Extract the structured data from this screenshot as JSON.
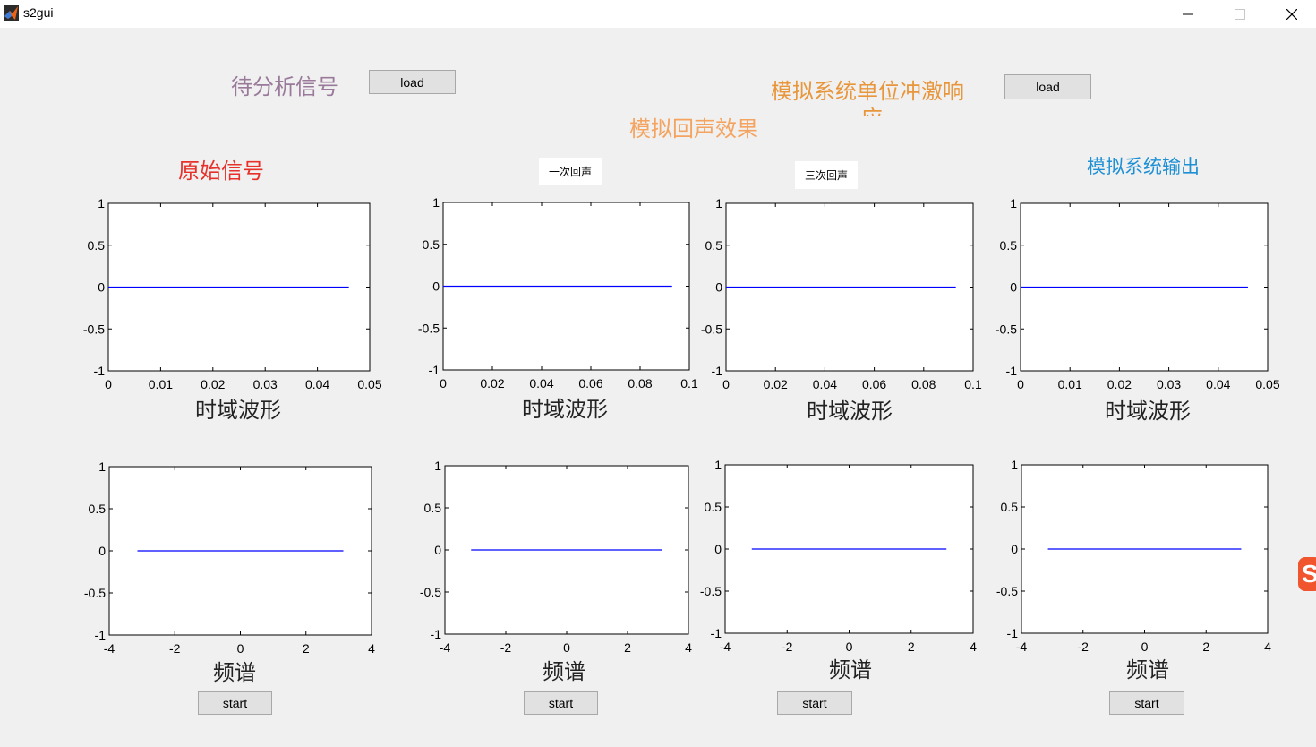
{
  "window": {
    "title": "s2gui"
  },
  "labels": {
    "signal_to_analyze": "待分析信号",
    "system_impulse_response": "模拟系统单位冲激响",
    "system_impulse_response_cont": "应",
    "echo_effect": "模拟回声效果",
    "original_signal": "原始信号",
    "single_echo": "一次回声",
    "triple_echo": "三次回声",
    "system_output": "模拟系统输出"
  },
  "buttons": {
    "load1": "load",
    "load2": "load",
    "start": "start"
  },
  "colors": {
    "original": "#e8302b",
    "echo": "#f4a460",
    "impulse": "#e8963c",
    "signal": "#9a7a9a",
    "output": "#1e90d4",
    "trace": "#0000ff"
  },
  "plots": {
    "time_xlabel": "时域波形",
    "freq_xlabel": "频谱",
    "y_ticks": [
      "1",
      "0.5",
      "0",
      "-0.5",
      "-1"
    ],
    "x_ticks_05": [
      "0",
      "0.01",
      "0.02",
      "0.03",
      "0.04",
      "0.05"
    ],
    "x_ticks_1": [
      "0",
      "0.02",
      "0.04",
      "0.06",
      "0.08",
      "0.1"
    ],
    "x_ticks_freq": [
      "-4",
      "-2",
      "0",
      "2",
      "4"
    ]
  },
  "chart_data": [
    {
      "type": "line",
      "name": "original-time",
      "xlim": [
        0,
        0.05
      ],
      "ylim": [
        -1,
        1
      ],
      "x": [
        0,
        0.046
      ],
      "y": [
        0,
        0
      ]
    },
    {
      "type": "line",
      "name": "echo1-time",
      "xlim": [
        0,
        0.1
      ],
      "ylim": [
        -1,
        1
      ],
      "x": [
        0,
        0.093
      ],
      "y": [
        0,
        0
      ]
    },
    {
      "type": "line",
      "name": "echo3-time",
      "xlim": [
        0,
        0.1
      ],
      "ylim": [
        -1,
        1
      ],
      "x": [
        0,
        0.093
      ],
      "y": [
        0,
        0
      ]
    },
    {
      "type": "line",
      "name": "output-time",
      "xlim": [
        0,
        0.05
      ],
      "ylim": [
        -1,
        1
      ],
      "x": [
        0,
        0.046
      ],
      "y": [
        0,
        0
      ]
    },
    {
      "type": "line",
      "name": "original-freq",
      "xlim": [
        -4,
        4
      ],
      "ylim": [
        -1,
        1
      ],
      "x": [
        -3.14,
        3.14
      ],
      "y": [
        0,
        0
      ]
    },
    {
      "type": "line",
      "name": "echo1-freq",
      "xlim": [
        -4,
        4
      ],
      "ylim": [
        -1,
        1
      ],
      "x": [
        -3.14,
        3.14
      ],
      "y": [
        0,
        0
      ]
    },
    {
      "type": "line",
      "name": "echo3-freq",
      "xlim": [
        -4,
        4
      ],
      "ylim": [
        -1,
        1
      ],
      "x": [
        -3.14,
        3.14
      ],
      "y": [
        0,
        0
      ]
    },
    {
      "type": "line",
      "name": "output-freq",
      "xlim": [
        -4,
        4
      ],
      "ylim": [
        -1,
        1
      ],
      "x": [
        -3.14,
        3.14
      ],
      "y": [
        0,
        0
      ]
    }
  ]
}
